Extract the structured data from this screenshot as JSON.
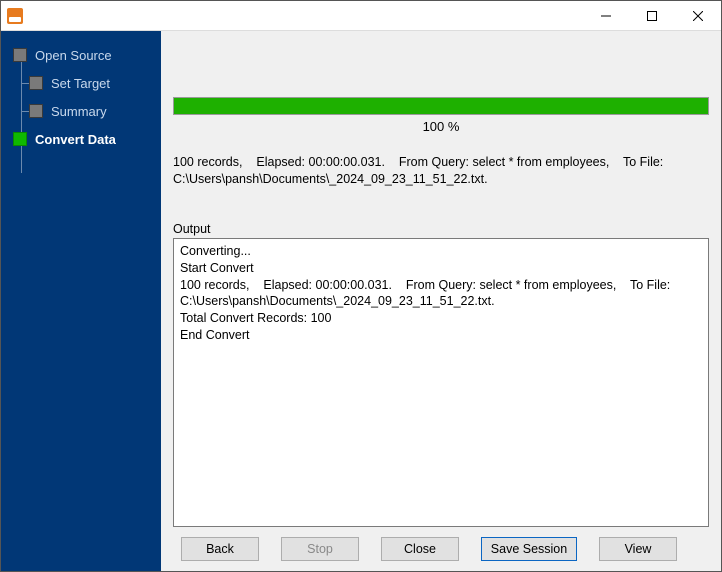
{
  "titlebar": {
    "title": ""
  },
  "sidebar": {
    "steps": [
      {
        "label": "Open Source"
      },
      {
        "label": "Set Target"
      },
      {
        "label": "Summary"
      },
      {
        "label": "Convert Data"
      }
    ]
  },
  "progress": {
    "percent_text": "100 %"
  },
  "summary_line": "100 records,    Elapsed: 00:00:00.031.    From Query: select * from employees,    To File: C:\\Users\\pansh\\Documents\\_2024_09_23_11_51_22.txt.",
  "output": {
    "label": "Output",
    "content": "Converting...\nStart Convert\n100 records,    Elapsed: 00:00:00.031.    From Query: select * from employees,    To File: C:\\Users\\pansh\\Documents\\_2024_09_23_11_51_22.txt.\nTotal Convert Records: 100\nEnd Convert"
  },
  "buttons": {
    "back": "Back",
    "stop": "Stop",
    "close": "Close",
    "save_session": "Save Session",
    "view": "View"
  }
}
